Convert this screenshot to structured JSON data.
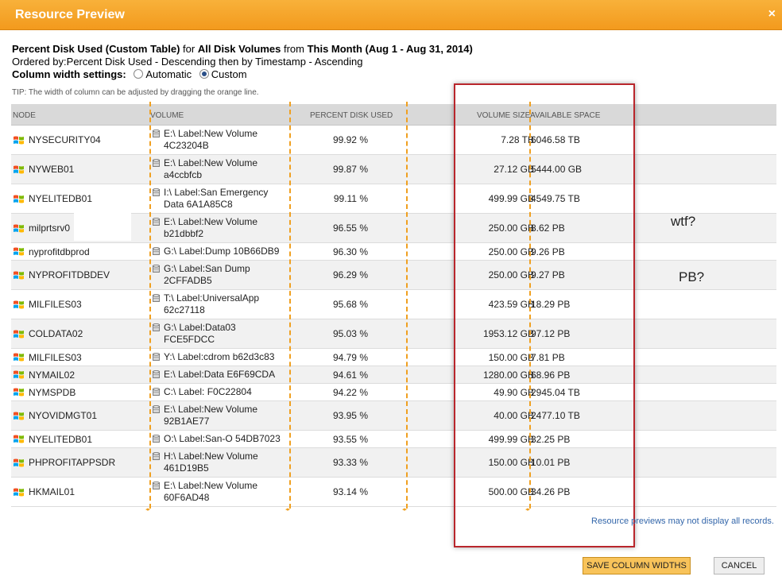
{
  "dialog": {
    "title": "Resource Preview",
    "close_glyph": "×"
  },
  "header": {
    "table_name": "Percent Disk Used (Custom Table)",
    "for_text": " for ",
    "scope": "All Disk Volumes",
    "from_text": " from ",
    "period": "This Month (Aug 1 - Aug 31, 2014)",
    "ordered_by": "Ordered by:Percent Disk Used - Descending then by Timestamp - Ascending",
    "width_label": "Column width settings:",
    "width_automatic": "Automatic",
    "width_custom": "Custom",
    "width_selected": "Custom"
  },
  "tip": "TIP: The width of column can be adjusted by dragging the orange line.",
  "table": {
    "columns": [
      "NODE",
      "VOLUME",
      "PERCENT DISK USED",
      "VOLUME SIZE",
      "AVAILABLE SPACE"
    ],
    "rows": [
      {
        "node": "NYSECURITY04",
        "volume": [
          "E:\\ Label:New Volume",
          "4C23204B"
        ],
        "pct": "99.92 %",
        "size": "7.28 TB",
        "avail": "6046.58 TB"
      },
      {
        "node": "NYWEB01",
        "volume": [
          "E:\\ Label:New Volume",
          "a4ccbfcb"
        ],
        "pct": "99.87 %",
        "size": "27.12 GB",
        "avail": "5444.00 GB"
      },
      {
        "node": "NYELITEDB01",
        "volume": [
          "I:\\ Label:San Emergency",
          "Data 6A1A85C8"
        ],
        "pct": "99.11 %",
        "size": "499.99 GB",
        "avail": "4549.75 TB"
      },
      {
        "node": "milprtsrv0",
        "volume": [
          "E:\\ Label:New Volume",
          "b21dbbf2"
        ],
        "pct": "96.55 %",
        "size": "250.00 GB",
        "avail": "8.62 PB"
      },
      {
        "node": "nyprofitdbprod",
        "volume": [
          "G:\\ Label:Dump 10B66DB9"
        ],
        "pct": "96.30 %",
        "size": "250.00 GB",
        "avail": "9.26 PB"
      },
      {
        "node": "NYPROFITDBDEV",
        "volume": [
          "G:\\ Label:San Dump",
          "2CFFADB5"
        ],
        "pct": "96.29 %",
        "size": "250.00 GB",
        "avail": "9.27 PB"
      },
      {
        "node": "MILFILES03",
        "volume": [
          "T:\\ Label:UniversalApp",
          "62c27118"
        ],
        "pct": "95.68 %",
        "size": "423.59 GB",
        "avail": "18.29 PB"
      },
      {
        "node": "COLDATA02",
        "volume": [
          "G:\\ Label:Data03",
          "FCE5FDCC"
        ],
        "pct": "95.03 %",
        "size": "1953.12 GB",
        "avail": "97.12 PB"
      },
      {
        "node": "MILFILES03",
        "volume": [
          "Y:\\ Label:cdrom b62d3c83"
        ],
        "pct": "94.79 %",
        "size": "150.00 GB",
        "avail": "7.81 PB"
      },
      {
        "node": "NYMAIL02",
        "volume": [
          "E:\\ Label:Data E6F69CDA"
        ],
        "pct": "94.61 %",
        "size": "1280.00 GB",
        "avail": "68.96 PB"
      },
      {
        "node": "NYMSPDB",
        "volume": [
          "C:\\ Label: F0C22804"
        ],
        "pct": "94.22 %",
        "size": "49.90 GB",
        "avail": "2945.04 TB"
      },
      {
        "node": "NYOVIDMGT01",
        "volume": [
          "E:\\ Label:New Volume",
          "92B1AE77"
        ],
        "pct": "93.95 %",
        "size": "40.00 GB",
        "avail": "2477.10 TB"
      },
      {
        "node": "NYELITEDB01",
        "volume": [
          "O:\\ Label:San-O 54DB7023"
        ],
        "pct": "93.55 %",
        "size": "499.99 GB",
        "avail": "32.25 PB"
      },
      {
        "node": "PHPROFITAPPSDR",
        "volume": [
          "H:\\ Label:New Volume",
          "461D19B5"
        ],
        "pct": "93.33 %",
        "size": "150.00 GB",
        "avail": "10.01 PB"
      },
      {
        "node": "HKMAIL01",
        "volume": [
          "E:\\ Label:New Volume",
          "60F6AD48"
        ],
        "pct": "93.14 %",
        "size": "500.00 GB",
        "avail": "34.26 PB"
      }
    ]
  },
  "annotations": {
    "wtf": "wtf?",
    "pb": "PB?"
  },
  "resize_marker_glyph": "◂▸",
  "footer": {
    "note": "Resource previews may not display all records.",
    "save_label": "SAVE COLUMN WIDTHS",
    "cancel_label": "CANCEL"
  },
  "colors": {
    "title_bar": "#f5a52a",
    "accent_button": "#f8c35a",
    "resize_line": "#f0a020",
    "highlight_box": "#b9262c",
    "link": "#3366aa"
  }
}
